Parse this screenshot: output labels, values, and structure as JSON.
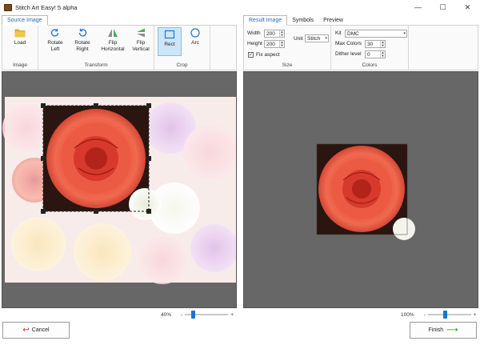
{
  "window": {
    "title": "Stitch Art Easy! 5 alpha",
    "minimize": "—",
    "maximize": "☐",
    "close": "✕"
  },
  "left": {
    "tab": "Source Image",
    "groups": {
      "image": "Image",
      "transform": "Transform",
      "crop": "Crop"
    },
    "buttons": {
      "load": "Load",
      "rotate_left": "Rotate Left",
      "rotate_right": "Rotate Right",
      "flip_h": "Flip Horizontal",
      "flip_v": "Flip Vertical",
      "rect": "Rect",
      "arc": "Arc"
    },
    "zoom": "40%",
    "zoom_minus": "-",
    "zoom_plus": "+",
    "zoom_level": 0.2,
    "cancel": "Cancel"
  },
  "right": {
    "tabs": [
      "Result Image",
      "Symbols",
      "Preview"
    ],
    "size": {
      "label": "Size",
      "width_label": "Width",
      "width": "200",
      "height_label": "Height",
      "height": "200",
      "unit_label": "Unit",
      "unit": "Stitch",
      "fix_aspect": "Fix aspect",
      "fix_aspect_checked": true,
      "check_mark": "✓"
    },
    "colors": {
      "label": "Colors",
      "kit_label": "Kit",
      "kit": "DMC",
      "max_colors_label": "Max Colors",
      "max_colors": "30",
      "dither_label": "Dither level",
      "dither": "0"
    },
    "zoom": "100%",
    "zoom_minus": "-",
    "zoom_plus": "+",
    "zoom_level": 0.4,
    "finish": "Finish"
  },
  "icons": {
    "cancel": "↩",
    "finish": "⟶",
    "spin_up": "▲",
    "spin_down": "▼",
    "combo_dropdown": "▾"
  },
  "colors": {
    "accent": "#1e74c9",
    "canvas_bg": "#676767",
    "selected_tool": "#cde6f7"
  }
}
